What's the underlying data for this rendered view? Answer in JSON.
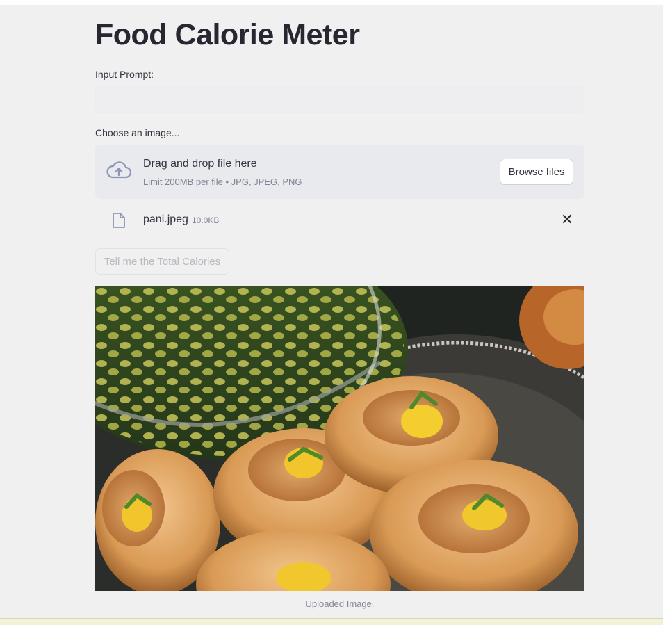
{
  "page": {
    "title": "Food Calorie Meter",
    "input_prompt": {
      "label": "Input Prompt:",
      "value": "",
      "placeholder": ""
    },
    "uploader": {
      "label": "Choose an image...",
      "drop_title": "Drag and drop file here",
      "drop_limits": "Limit 200MB per file • JPG, JPEG, PNG",
      "browse_label": "Browse files",
      "icon": "cloud-upload-icon"
    },
    "uploaded_file": {
      "name": "pani.jpeg",
      "size": "10.0KB",
      "icon": "file-icon",
      "remove_icon": "close-icon",
      "remove_glyph": "✕"
    },
    "submit_button": "Tell me the Total Calories",
    "image_caption": "Uploaded Image."
  },
  "colors": {
    "background": "#f0f0f0",
    "text": "#31333f",
    "muted": "#808495",
    "disabled_text": "#b8b9c1"
  }
}
